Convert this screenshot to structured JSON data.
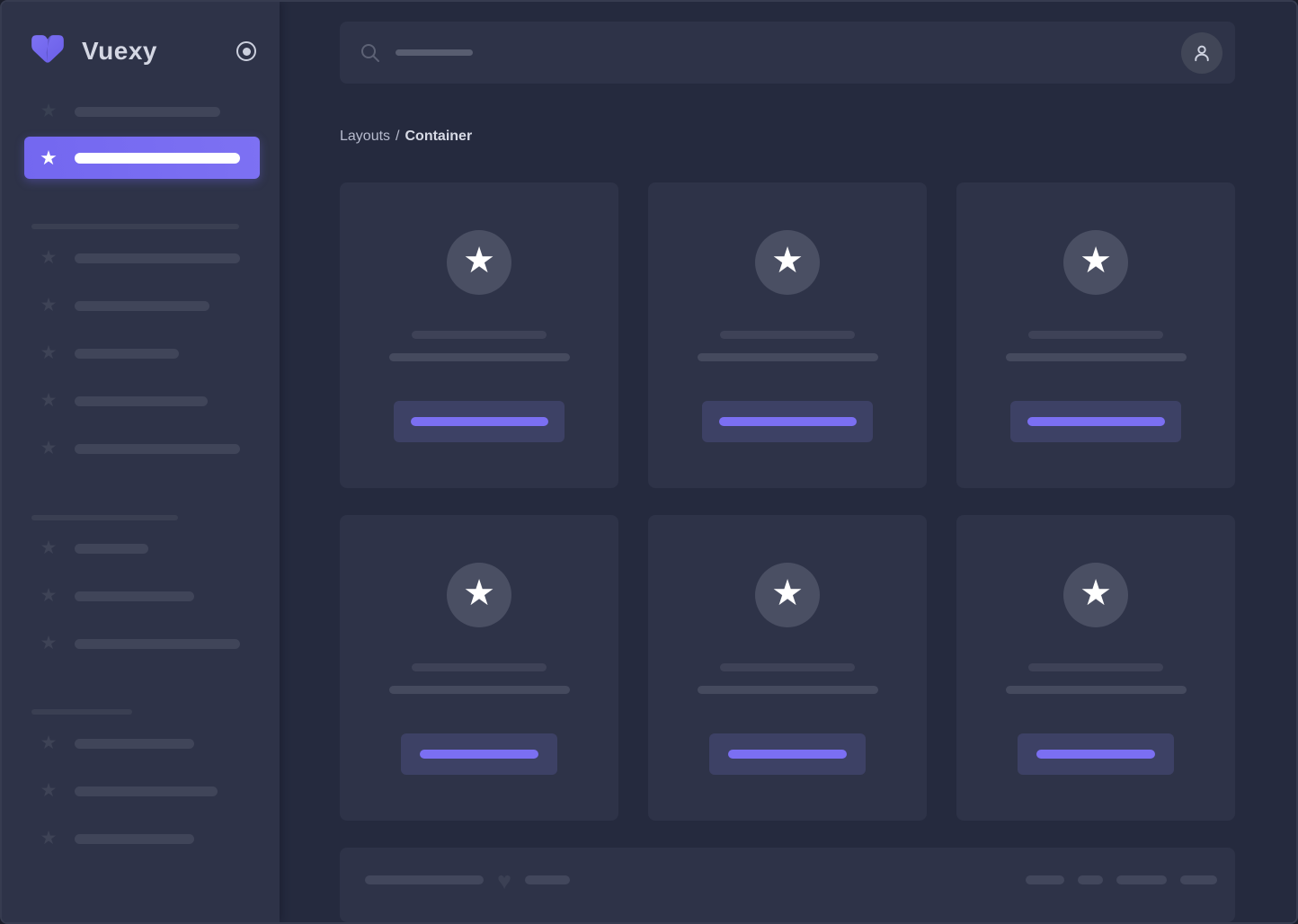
{
  "app": {
    "name": "Vuexy"
  },
  "sidebar": {
    "brand": "Vuexy",
    "toggle_icon": "radio-dot-icon",
    "active_item_index": 1,
    "sections": [
      {
        "items": 5
      },
      {
        "items": 3
      },
      {
        "items": 3
      }
    ]
  },
  "topbar": {
    "search_icon": "search-icon",
    "avatar_icon": "user-icon"
  },
  "breadcrumb": {
    "parent": "Layouts",
    "separator": "/",
    "current": "Container"
  },
  "cards": {
    "count": 6,
    "badge_icon": "star-icon",
    "button": "placeholder-action"
  },
  "footer": {
    "heart_icon": "heart-icon"
  },
  "icons": {
    "star": "★",
    "heart": "♥"
  },
  "colors": {
    "accent": "#7367f0",
    "button_bar": "#7b6ff2",
    "main_bg": "#252a3e",
    "panel_bg": "#2e3348"
  }
}
